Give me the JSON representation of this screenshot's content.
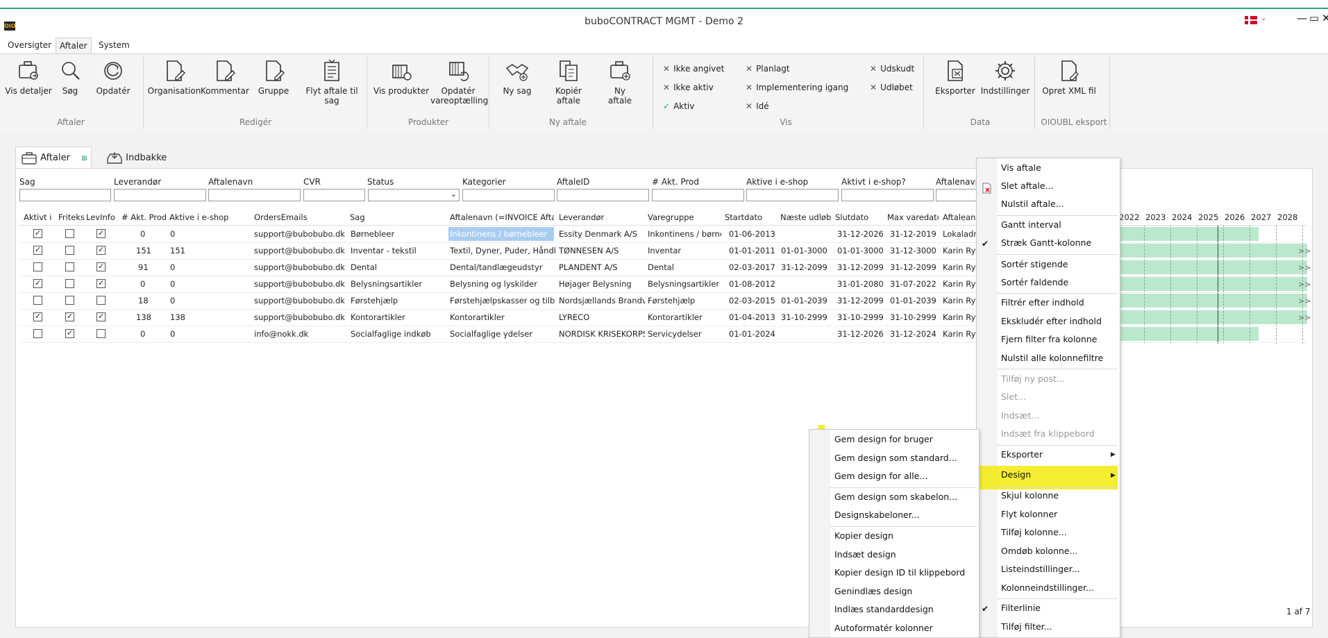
{
  "window": {
    "title": "buboCONTRACT MGMT - Demo 2",
    "logo_text": "OIO",
    "minimize": "—",
    "restore": "▭",
    "close": "✕",
    "lang_chevron": "⌄"
  },
  "menu_tabs": [
    {
      "label": "Oversigter",
      "active": false
    },
    {
      "label": "Aftaler",
      "active": true
    },
    {
      "label": "System",
      "active": false
    }
  ],
  "ribbon": {
    "buttons": [
      {
        "label": "Vis detaljer",
        "icon": "briefcase-view-icon"
      },
      {
        "label": "Søg",
        "icon": "search-icon"
      },
      {
        "label": "Opdatér",
        "icon": "refresh-icon"
      },
      {
        "label": "Organisation",
        "icon": "document-edit-icon"
      },
      {
        "label": "Kommentar",
        "icon": "document-edit-icon"
      },
      {
        "label": "Gruppe",
        "icon": "document-edit-icon"
      },
      {
        "label": "Flyt aftale til sag",
        "icon": "document-move-icon"
      },
      {
        "label": "Vis produkter",
        "icon": "products-view-icon"
      },
      {
        "label": "Opdatér vareoptælling",
        "icon": "products-refresh-icon"
      },
      {
        "label": "Ny sag",
        "icon": "handshake-icon"
      },
      {
        "label": "Kopiér aftale",
        "icon": "copy-document-icon"
      },
      {
        "label": "Ny aftale",
        "icon": "briefcase-add-icon"
      },
      {
        "label": "Eksporter",
        "icon": "excel-export-icon"
      },
      {
        "label": "Indstillinger",
        "icon": "gear-icon"
      },
      {
        "label": "Opret XML fil",
        "icon": "xml-document-icon"
      }
    ],
    "groups": [
      "Aftaler",
      "Redigér",
      "Produkter",
      "Ny aftale",
      "Vis",
      "Data",
      "OIOUBL eksport"
    ],
    "vis_filters": [
      {
        "label": "Ikke angivet",
        "checked": false
      },
      {
        "label": "Ikke aktiv",
        "checked": false
      },
      {
        "label": "Aktiv",
        "checked": true
      },
      {
        "label": "Planlagt",
        "checked": false
      },
      {
        "label": "Implementering igang",
        "checked": false
      },
      {
        "label": "Idé",
        "checked": false
      },
      {
        "label": "Udskudt",
        "checked": false
      },
      {
        "label": "Udløbet",
        "checked": false
      }
    ]
  },
  "doc_tabs": [
    {
      "label": "Aftaler",
      "active": true
    },
    {
      "label": "Indbakke",
      "active": false
    }
  ],
  "filters": [
    "Sag",
    "Leverandør",
    "Aftalenavn",
    "CVR",
    "Status",
    "Kategorier",
    "AftaleID",
    "# Akt. Prod",
    "Aktive i e-shop",
    "Aktivt i e-shop?",
    "Aftalenavn"
  ],
  "columns": [
    "Aktivt i e",
    "Friteks",
    "LevInfo",
    "# Akt. Prod",
    "Aktive i e-shop",
    "OrdersEmails",
    "Sag",
    "Aftalenavn (=INVOICE Aftal",
    "Leverandør",
    "Varegruppe",
    "Startdato",
    "Næste udløb",
    "Slutdato",
    "Max varedato",
    "Aftaleans"
  ],
  "rows": [
    {
      "c1": true,
      "c2": false,
      "c3": true,
      "prod": "0",
      "eshop": "0",
      "email": "support@bubobubo.dk",
      "sag": "Børnebleer",
      "navn": "Inkontinens / børnebleer",
      "lev": "Essity Denmark A/S",
      "vg": "Inkontinens / børnel",
      "start": "01-06-2013",
      "naeste": "",
      "slut": "31-12-2026",
      "max": "31-12-2019",
      "ans": "Lokaladm",
      "more": ""
    },
    {
      "c1": true,
      "c2": false,
      "c3": true,
      "prod": "151",
      "eshop": "151",
      "email": "support@bubobubo.dk",
      "sag": "Inventar - tekstil",
      "navn": "Textil, Dyner, Puder, Håndklæ",
      "lev": "TØNNESEN A/S",
      "vg": "Inventar",
      "start": "01-01-2011",
      "naeste": "01-01-3000",
      "slut": "01-01-3000",
      "max": "31-12-3000",
      "ans": "Karin Ryt",
      "more": ">>"
    },
    {
      "c1": false,
      "c2": false,
      "c3": true,
      "prod": "91",
      "eshop": "0",
      "email": "support@bubobubo.dk",
      "sag": "Dental",
      "navn": "Dental/tandlægeudstyr",
      "lev": "PLANDENT A/S",
      "vg": "Dental",
      "start": "02-03-2017",
      "naeste": "31-12-2099",
      "slut": "31-12-2099",
      "max": "31-12-2099",
      "ans": "Karin Ryt",
      "more": ">>"
    },
    {
      "c1": true,
      "c2": false,
      "c3": true,
      "prod": "0",
      "eshop": "0",
      "email": "support@bubobubo.dk",
      "sag": "Belysningsartikler",
      "navn": "Belysning og lyskilder",
      "lev": "Højager Belysning",
      "vg": "Belysningsartikler",
      "start": "01-08-2012",
      "naeste": "",
      "slut": "31-01-2080",
      "max": "31-07-2022",
      "ans": "Karin Ryt",
      "more": ">>"
    },
    {
      "c1": false,
      "c2": false,
      "c3": false,
      "prod": "18",
      "eshop": "0",
      "email": "support@bubobubo.dk",
      "sag": "Førstehjælp",
      "navn": "Førstehjælpskasser og tilbeh",
      "lev": "Nordsjællands Brandva",
      "vg": "Førstehjælp",
      "start": "02-03-2015",
      "naeste": "01-01-2039",
      "slut": "31-12-2099",
      "max": "01-01-2039",
      "ans": "Karin Ryt",
      "more": ">>"
    },
    {
      "c1": true,
      "c2": true,
      "c3": true,
      "prod": "138",
      "eshop": "138",
      "email": "support@bubobubo.dk",
      "sag": "Kontorartikler",
      "navn": "Kontorartikler",
      "lev": "LYRECO",
      "vg": "Kontorartikler",
      "start": "01-04-2013",
      "naeste": "31-10-2999",
      "slut": "31-10-2999",
      "max": "31-10-2999",
      "ans": "Karin Ryt",
      "more": ">>"
    },
    {
      "c1": false,
      "c2": true,
      "c3": false,
      "prod": "0",
      "eshop": "0",
      "email": "info@nokk.dk",
      "sag": "Socialfaglige indkøb",
      "navn": "Socialfaglige ydelser",
      "lev": "NORDISK KRISEKORPS",
      "vg": "Servicydelser",
      "start": "01-01-2024",
      "naeste": "",
      "slut": "31-12-2026",
      "max": "31-12-2024",
      "ans": "Karin Ryt",
      "more": ""
    }
  ],
  "gantt_years": [
    "2022",
    "2023",
    "2024",
    "2025",
    "2026",
    "2027",
    "2028"
  ],
  "pager": "1 af 7",
  "context_menu": {
    "items": [
      {
        "label": "Vis aftale",
        "disabled": false,
        "checked": false
      },
      {
        "label": "Slet aftale...",
        "disabled": false,
        "checked": false
      },
      {
        "label": "Nulstil aftale...",
        "disabled": false,
        "checked": false
      },
      {
        "label": "Gantt interval",
        "disabled": false,
        "checked": false
      },
      {
        "label": "Stræk Gantt-kolonne",
        "disabled": false,
        "checked": true
      },
      {
        "label": "Sortér stigende",
        "disabled": false,
        "checked": false
      },
      {
        "label": "Sortér faldende",
        "disabled": false,
        "checked": false
      },
      {
        "label": "Filtrér efter indhold",
        "disabled": false,
        "checked": false
      },
      {
        "label": "Ekskludér efter indhold",
        "disabled": false,
        "checked": false
      },
      {
        "label": "Fjern filter fra kolonne",
        "disabled": false,
        "checked": false
      },
      {
        "label": "Nulstil alle kolonnefiltre",
        "disabled": false,
        "checked": false
      },
      {
        "label": "Tilføj ny post...",
        "disabled": true,
        "checked": false
      },
      {
        "label": "Slet...",
        "disabled": true,
        "checked": false
      },
      {
        "label": "Indsæt...",
        "disabled": true,
        "checked": false
      },
      {
        "label": "Indsæt fra klippebord",
        "disabled": true,
        "checked": false
      },
      {
        "label": "Eksporter",
        "disabled": false,
        "checked": false
      },
      {
        "label": "Design",
        "disabled": false,
        "checked": false
      },
      {
        "label": "Skjul kolonne",
        "disabled": false,
        "checked": false
      },
      {
        "label": "Flyt kolonner",
        "disabled": false,
        "checked": false
      },
      {
        "label": "Tilføj kolonne...",
        "disabled": false,
        "checked": false
      },
      {
        "label": "Omdøb kolonne...",
        "disabled": false,
        "checked": false
      },
      {
        "label": "Listeindstillinger...",
        "disabled": false,
        "checked": false
      },
      {
        "label": "Kolonneindstillinger...",
        "disabled": false,
        "checked": false
      },
      {
        "label": "Filterlinie",
        "disabled": false,
        "checked": true
      },
      {
        "label": "Tilføj filter...",
        "disabled": false,
        "checked": false
      }
    ]
  },
  "design_submenu": {
    "items": [
      "Gem design for bruger",
      "Gem design som standard...",
      "Gem design for alle...",
      "Gem design som skabelon...",
      "Designskabeloner...",
      "Kopier design",
      "Indsæt design",
      "Kopier design ID til klippebord",
      "Genindlæs design",
      "Indlæs standarddesign",
      "Autoformatér kolonner"
    ]
  },
  "colors": {
    "accent": "#2aa37a",
    "gantt": "#b9e8cc",
    "highlight": "#f3ea0d",
    "selection": "#a9cdf0"
  }
}
